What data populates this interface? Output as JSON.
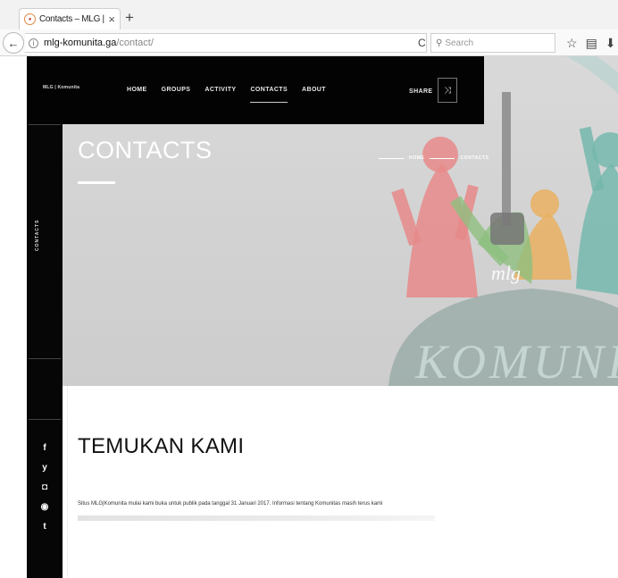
{
  "browser": {
    "tab_title": "Contacts – MLG | Komunita",
    "tab_close": "×",
    "new_tab": "+",
    "back": "←",
    "url_host": "mlg-komunita.ga",
    "url_path": "/contact/",
    "reload": "C",
    "search_placeholder": "Search",
    "icons": [
      "star-icon",
      "clipboard-icon",
      "download-icon"
    ]
  },
  "site": {
    "brand": "MLG | Komunita",
    "nav": [
      "HOME",
      "GROUPS",
      "ACTIVITY",
      "CONTACTS",
      "ABOUT"
    ],
    "active_nav": "CONTACTS",
    "share_label": "SHARE",
    "side_label": "CONTACTS",
    "social": [
      "f",
      "y",
      "◘",
      "◉",
      "t"
    ]
  },
  "hero": {
    "title": "CONTACTS",
    "breadcrumb": [
      "HOME",
      "CONTACTS"
    ]
  },
  "content": {
    "heading": "TEMUKAN KAMI",
    "paragraph": "Situs MLG|Komunita mulai kami buka untuk publik pada tanggal 31 Januari 2017. Informasi tentang Komunitas masih terus kami"
  },
  "colors": {
    "nav_bg": "#030303",
    "hero_bg": "#d6d6d6",
    "accent_red": "#e57373",
    "accent_green": "#6ea86a",
    "accent_teal": "#5aa39a"
  }
}
